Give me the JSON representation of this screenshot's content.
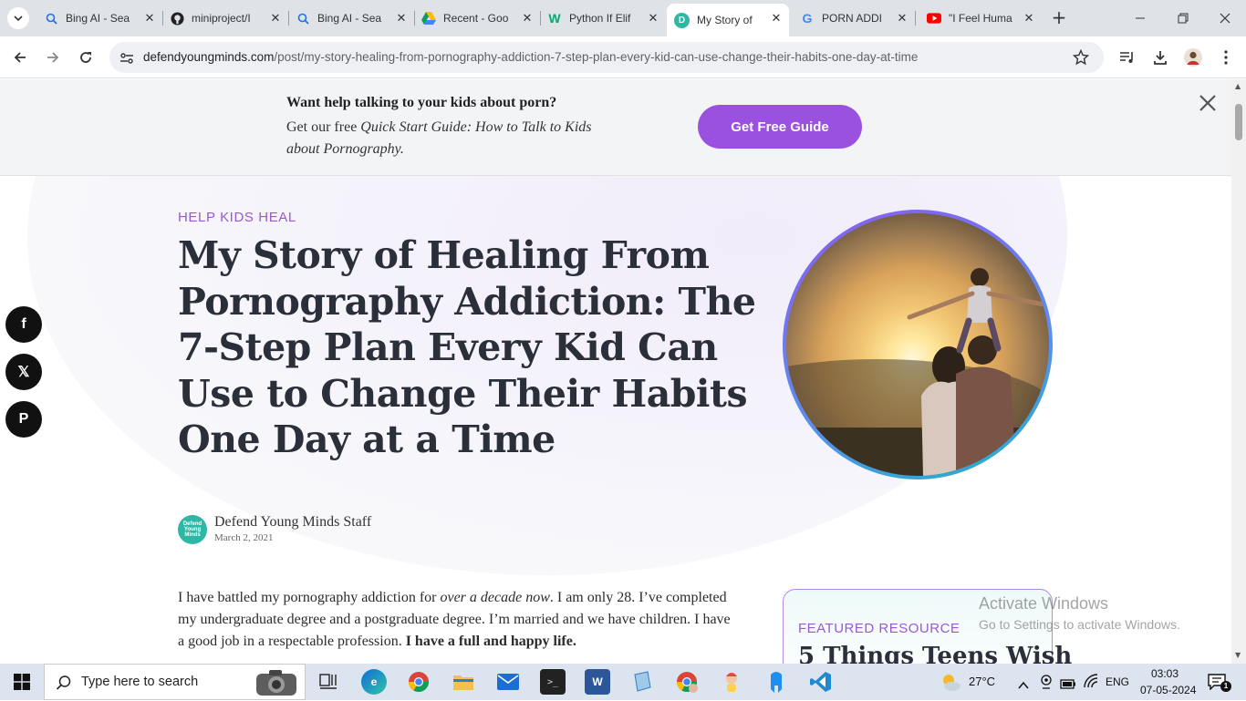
{
  "browser": {
    "tabs": [
      {
        "title": "Bing AI - Sea",
        "icon": "search-icon",
        "active": false
      },
      {
        "title": "miniproject/I",
        "icon": "github-icon",
        "active": false
      },
      {
        "title": "Bing AI - Sea",
        "icon": "search-icon",
        "active": false
      },
      {
        "title": "Recent - Goo",
        "icon": "google-drive-icon",
        "active": false
      },
      {
        "title": "Python If Elif",
        "icon": "w3schools-icon",
        "active": false
      },
      {
        "title": "My Story of",
        "icon": "dym-favicon",
        "active": true
      },
      {
        "title": "PORN ADDIC",
        "icon": "google-icon",
        "active": false
      },
      {
        "title": "\"I Feel Huma",
        "icon": "youtube-icon",
        "active": false
      }
    ],
    "favicon_letters": {
      "dym": "D",
      "w3": "W"
    },
    "url_domain": "defendyoungminds.com",
    "url_path": "/post/my-story-healing-from-pornography-addiction-7-step-plan-every-kid-can-use-change-their-habits-one-day-at-time"
  },
  "promo": {
    "question": "Want help talking to your kids about porn?",
    "text_prefix": "Get our free ",
    "text_italic": "Quick Start Guide: How to Talk to Kids about Pornography.",
    "button_label": "Get Free Guide"
  },
  "article": {
    "category": "HELP KIDS HEAL",
    "title": "My Story of Healing From Pornography Addiction: The 7-Step Plan Every Kid Can Use to Change Their Habits One Day at a Time",
    "author": "Defend Young Minds Staff",
    "author_avatar_text": "Defend Young Minds",
    "date": "March 2, 2021",
    "body": {
      "p1": "I have battled my pornography addiction for ",
      "p1_italic": "over a decade now",
      "p1_cont": ". I am only 28. I’ve completed my undergraduate degree and a postgraduate degree. I’m married and we have children. I have a good job in a respectable profession. ",
      "p1_bold": "I have a full and happy life."
    }
  },
  "featured": {
    "label": "FEATURED RESOURCE",
    "title": "5 Things Teens Wish"
  },
  "social": {
    "facebook": "f",
    "x": "𝕏",
    "pinterest": "P"
  },
  "watermark": {
    "title": "Activate Windows",
    "subtitle": "Go to Settings to activate Windows."
  },
  "taskbar": {
    "search_placeholder": "Type here to search",
    "weather": "27°C",
    "language": "ENG",
    "time": "03:03",
    "date": "07-05-2024",
    "notification_count": "1"
  },
  "colors": {
    "accent_purple": "#9b51e0",
    "category_purple": "#9b59d0",
    "heading": "#2b2f3a"
  }
}
